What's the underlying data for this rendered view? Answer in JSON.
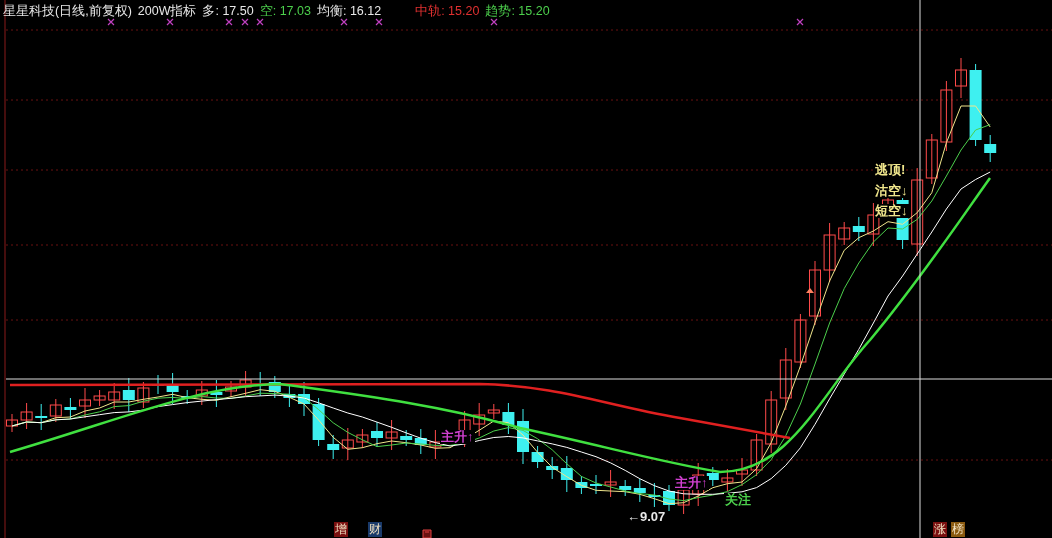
{
  "header": {
    "title": "星星科技(日线,前复权)",
    "indicator": "200W指标",
    "readings": [
      {
        "label": "多:",
        "value": "17.50",
        "color": "#e8e8e8"
      },
      {
        "label": "空:",
        "value": "17.03",
        "color": "#4ccf4c"
      },
      {
        "label": "均衡:",
        "value": "16.12",
        "color": "#e8e8e8"
      }
    ],
    "trend_readings": [
      {
        "label": "中轨:",
        "value": "15.20",
        "color": "#e03030"
      },
      {
        "label": "趋势:",
        "value": "15.20",
        "color": "#4ccf4c"
      }
    ]
  },
  "annotations": [
    {
      "text": "逃顶!",
      "color": "#f0e68c"
    },
    {
      "text": "沽空↓",
      "color": "#f0e68c"
    },
    {
      "text": "短空↓",
      "color": "#f0e68c"
    },
    {
      "text": "主升↑",
      "color": "#d040d0"
    },
    {
      "text": "主升↑",
      "color": "#d040d0"
    },
    {
      "text": "关注",
      "color": "#4ccf4c"
    },
    {
      "text": "←9.07",
      "color": "#e8e8e8"
    }
  ],
  "bottom_markers": [
    {
      "text": "增",
      "color": "#7a1010"
    },
    {
      "text": "财",
      "color": "#1a3a6a"
    },
    {
      "text": "涨",
      "color": "#7a1010"
    },
    {
      "text": "榜",
      "color": "#8a5a10"
    }
  ]
}
